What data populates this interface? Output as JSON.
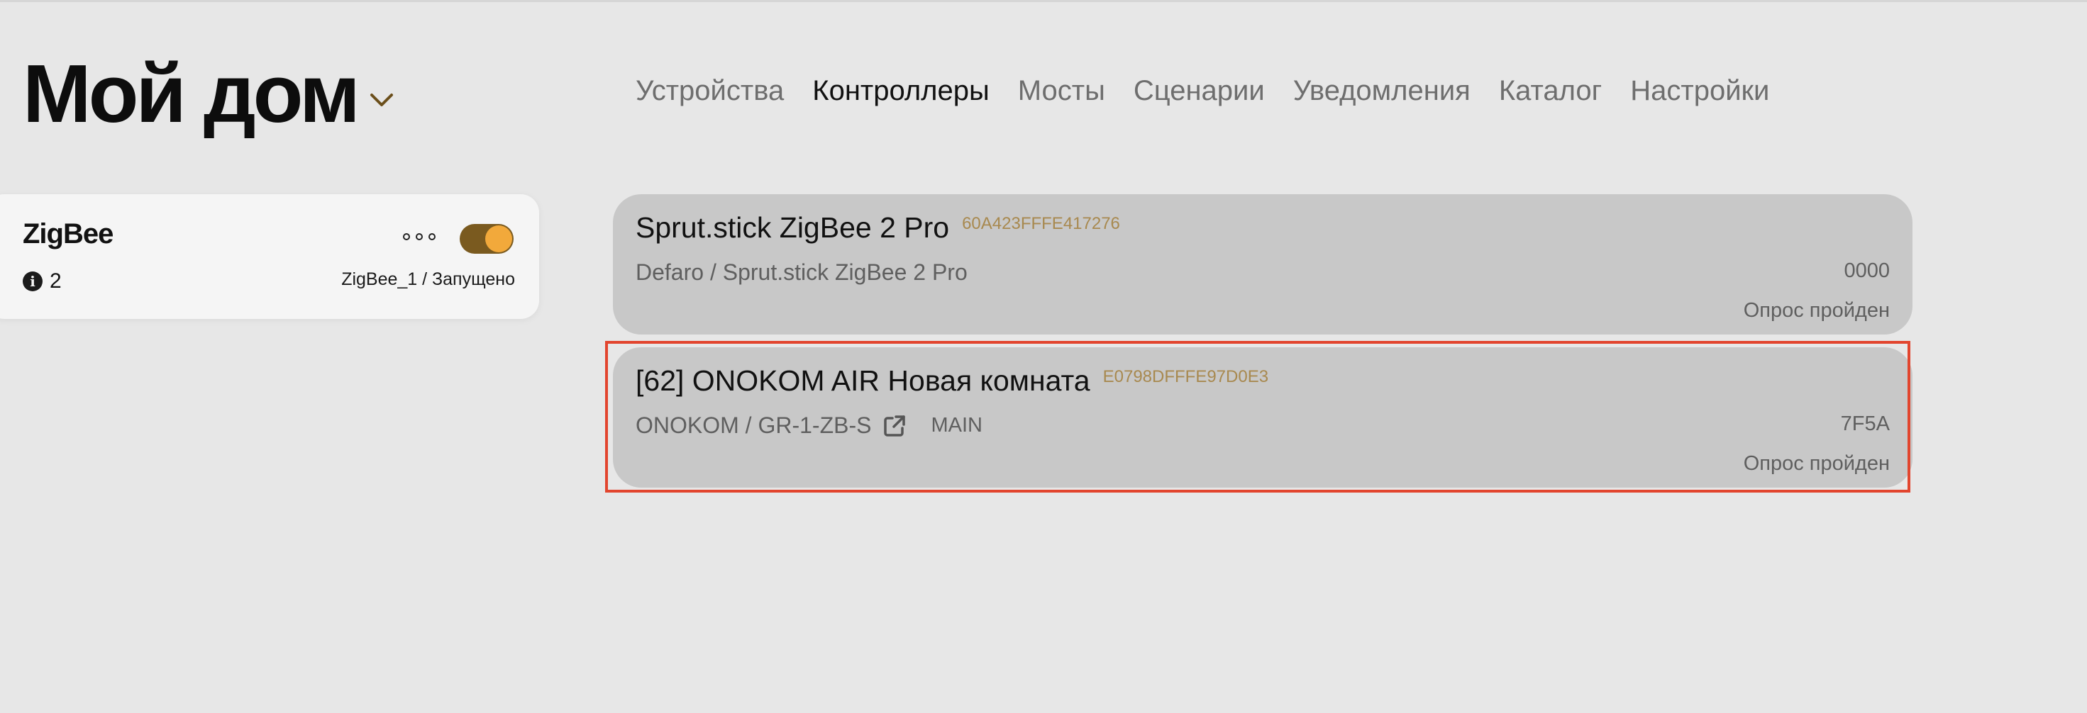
{
  "header": {
    "home_title": "Мой дом",
    "nav": [
      {
        "label": "Устройства",
        "active": false
      },
      {
        "label": "Контроллеры",
        "active": true
      },
      {
        "label": "Мосты",
        "active": false
      },
      {
        "label": "Сценарии",
        "active": false
      },
      {
        "label": "Уведомления",
        "active": false
      },
      {
        "label": "Каталог",
        "active": false
      },
      {
        "label": "Настройки",
        "active": false
      }
    ]
  },
  "controller": {
    "name": "ZigBee",
    "info_count": "2",
    "status": "ZigBee_1 / Запущено",
    "enabled": true
  },
  "devices": [
    {
      "name": "Sprut.stick ZigBee 2 Pro",
      "ieee": "60A423FFFE417276",
      "model": "Defaro / Sprut.stick ZigBee 2 Pro",
      "power": "",
      "address": "0000",
      "state": "Опрос пройден"
    },
    {
      "name": "[62] ONOKOM AIR Новая комната",
      "ieee": "E0798DFFFE97D0E3",
      "model": "ONOKOM / GR-1-ZB-S",
      "power": "MAIN",
      "address": "7F5A",
      "state": "Опрос пройден"
    }
  ],
  "colors": {
    "accent": "#f2a93b",
    "toggle_track": "#7a5a1f",
    "ieee_text": "#a8894f",
    "highlight": "#e2452e"
  }
}
